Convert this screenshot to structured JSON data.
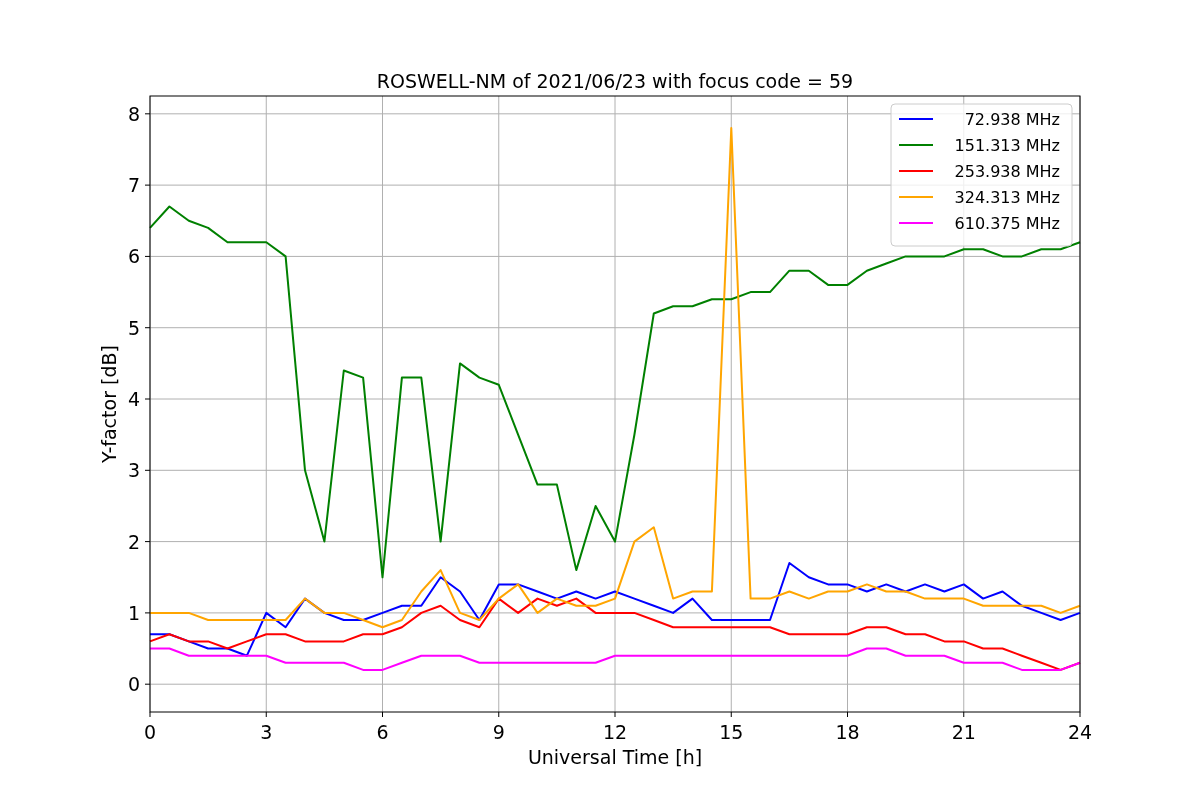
{
  "figure": {
    "chart_data": {
      "type": "line",
      "title": "ROSWELL-NM of 2021/06/23 with focus code = 59",
      "xlabel": "Universal Time [h]",
      "ylabel": "Y-factor [dB]",
      "x": [
        0,
        0.5,
        1,
        1.5,
        2,
        2.5,
        3,
        3.5,
        4,
        4.5,
        5,
        5.5,
        6,
        6.5,
        7,
        7.5,
        8,
        8.5,
        9,
        9.5,
        10,
        10.5,
        11,
        11.5,
        12,
        12.5,
        13,
        13.5,
        14,
        14.5,
        15,
        15.5,
        16,
        16.5,
        17,
        17.5,
        18,
        18.5,
        19,
        19.5,
        20,
        20.5,
        21,
        21.5,
        22,
        22.5,
        23,
        23.5,
        24
      ],
      "series": [
        {
          "name": "72.938 MHz",
          "color": "#0000ff",
          "values": [
            0.7,
            0.7,
            0.6,
            0.5,
            0.5,
            0.4,
            1.0,
            0.8,
            1.2,
            1.0,
            0.9,
            0.9,
            1.0,
            1.1,
            1.1,
            1.5,
            1.3,
            0.9,
            1.4,
            1.4,
            1.3,
            1.2,
            1.3,
            1.2,
            1.3,
            1.2,
            1.1,
            1.0,
            1.2,
            0.9,
            0.9,
            0.9,
            0.9,
            1.7,
            1.5,
            1.4,
            1.4,
            1.3,
            1.4,
            1.3,
            1.4,
            1.3,
            1.4,
            1.2,
            1.3,
            1.1,
            1.0,
            0.9,
            1.0
          ]
        },
        {
          "name": "151.313 MHz",
          "color": "#008000",
          "values": [
            6.4,
            6.7,
            6.5,
            6.4,
            6.2,
            6.2,
            6.2,
            6.0,
            3.0,
            2.0,
            4.4,
            4.3,
            1.5,
            4.3,
            4.3,
            2.0,
            4.5,
            4.3,
            4.2,
            3.5,
            2.8,
            2.8,
            1.6,
            2.5,
            2.0,
            3.5,
            5.2,
            5.3,
            5.3,
            5.4,
            5.4,
            5.5,
            5.5,
            5.8,
            5.8,
            5.6,
            5.6,
            5.8,
            5.9,
            6.0,
            6.0,
            6.0,
            6.1,
            6.1,
            6.0,
            6.0,
            6.1,
            6.1,
            6.2
          ]
        },
        {
          "name": "253.938 MHz",
          "color": "#ff0000",
          "values": [
            0.6,
            0.7,
            0.6,
            0.6,
            0.5,
            0.6,
            0.7,
            0.7,
            0.6,
            0.6,
            0.6,
            0.7,
            0.7,
            0.8,
            1.0,
            1.1,
            0.9,
            0.8,
            1.2,
            1.0,
            1.2,
            1.1,
            1.2,
            1.0,
            1.0,
            1.0,
            0.9,
            0.8,
            0.8,
            0.8,
            0.8,
            0.8,
            0.8,
            0.7,
            0.7,
            0.7,
            0.7,
            0.8,
            0.8,
            0.7,
            0.7,
            0.6,
            0.6,
            0.5,
            0.5,
            0.4,
            0.3,
            0.2,
            0.3
          ]
        },
        {
          "name": "324.313 MHz",
          "color": "#ffa500",
          "values": [
            1.0,
            1.0,
            1.0,
            0.9,
            0.9,
            0.9,
            0.9,
            0.9,
            1.2,
            1.0,
            1.0,
            0.9,
            0.8,
            0.9,
            1.3,
            1.6,
            1.0,
            0.9,
            1.2,
            1.4,
            1.0,
            1.2,
            1.1,
            1.1,
            1.2,
            2.0,
            2.2,
            1.2,
            1.3,
            1.3,
            7.8,
            1.2,
            1.2,
            1.3,
            1.2,
            1.3,
            1.3,
            1.4,
            1.3,
            1.3,
            1.2,
            1.2,
            1.2,
            1.1,
            1.1,
            1.1,
            1.1,
            1.0,
            1.1
          ]
        },
        {
          "name": "610.375 MHz",
          "color": "#ff00ff",
          "values": [
            0.5,
            0.5,
            0.4,
            0.4,
            0.4,
            0.4,
            0.4,
            0.3,
            0.3,
            0.3,
            0.3,
            0.2,
            0.2,
            0.3,
            0.4,
            0.4,
            0.4,
            0.3,
            0.3,
            0.3,
            0.3,
            0.3,
            0.3,
            0.3,
            0.4,
            0.4,
            0.4,
            0.4,
            0.4,
            0.4,
            0.4,
            0.4,
            0.4,
            0.4,
            0.4,
            0.4,
            0.4,
            0.5,
            0.5,
            0.4,
            0.4,
            0.4,
            0.3,
            0.3,
            0.3,
            0.2,
            0.2,
            0.2,
            0.3
          ]
        }
      ],
      "grid": true,
      "legend": true,
      "xlim": [
        0,
        24
      ],
      "ylim": [
        -0.39,
        8.25
      ],
      "xticks": [
        0,
        3,
        6,
        9,
        12,
        15,
        18,
        21,
        24
      ],
      "yticks": [
        0,
        1,
        2,
        3,
        4,
        5,
        6,
        7,
        8
      ]
    }
  }
}
